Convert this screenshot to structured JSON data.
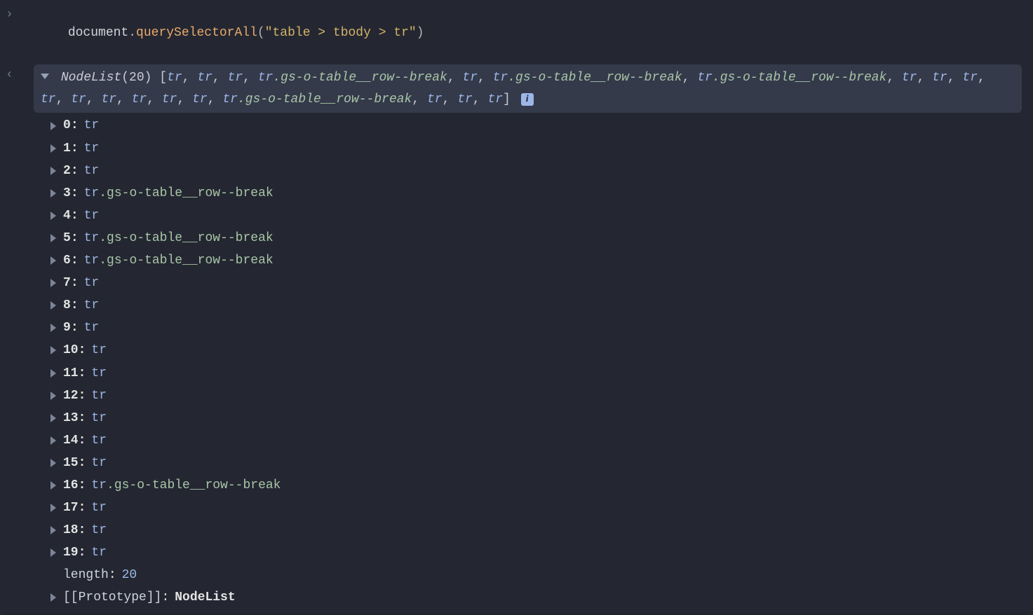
{
  "console": {
    "input": {
      "object": "document",
      "dot1": ".",
      "method": "querySelectorAll",
      "openParen": "(",
      "argString": "\"table > tbody > tr\"",
      "closeParen": ")"
    },
    "result": {
      "typeLabel": "NodeList",
      "count": "20",
      "openCount": "(",
      "closeCount": ")",
      "openBracket": "[",
      "items": [
        {
          "tag": "tr",
          "cls": null
        },
        {
          "tag": "tr",
          "cls": null
        },
        {
          "tag": "tr",
          "cls": null
        },
        {
          "tag": "tr",
          "cls": ".gs-o-table__row--break"
        },
        {
          "tag": "tr",
          "cls": null
        },
        {
          "tag": "tr",
          "cls": ".gs-o-table__row--break"
        },
        {
          "tag": "tr",
          "cls": ".gs-o-table__row--break"
        },
        {
          "tag": "tr",
          "cls": null
        },
        {
          "tag": "tr",
          "cls": null
        },
        {
          "tag": "tr",
          "cls": null
        },
        {
          "tag": "tr",
          "cls": null
        },
        {
          "tag": "tr",
          "cls": null
        },
        {
          "tag": "tr",
          "cls": null
        },
        {
          "tag": "tr",
          "cls": null
        },
        {
          "tag": "tr",
          "cls": null
        },
        {
          "tag": "tr",
          "cls": null
        },
        {
          "tag": "tr",
          "cls": ".gs-o-table__row--break"
        },
        {
          "tag": "tr",
          "cls": null
        },
        {
          "tag": "tr",
          "cls": null
        },
        {
          "tag": "tr",
          "cls": null
        }
      ],
      "closeBracket": "]",
      "infoBadge": "i",
      "tree": {
        "indexed": [
          {
            "idx": "0",
            "tag": "tr",
            "cls": null
          },
          {
            "idx": "1",
            "tag": "tr",
            "cls": null
          },
          {
            "idx": "2",
            "tag": "tr",
            "cls": null
          },
          {
            "idx": "3",
            "tag": "tr",
            "cls": ".gs-o-table__row--break"
          },
          {
            "idx": "4",
            "tag": "tr",
            "cls": null
          },
          {
            "idx": "5",
            "tag": "tr",
            "cls": ".gs-o-table__row--break"
          },
          {
            "idx": "6",
            "tag": "tr",
            "cls": ".gs-o-table__row--break"
          },
          {
            "idx": "7",
            "tag": "tr",
            "cls": null
          },
          {
            "idx": "8",
            "tag": "tr",
            "cls": null
          },
          {
            "idx": "9",
            "tag": "tr",
            "cls": null
          },
          {
            "idx": "10",
            "tag": "tr",
            "cls": null
          },
          {
            "idx": "11",
            "tag": "tr",
            "cls": null
          },
          {
            "idx": "12",
            "tag": "tr",
            "cls": null
          },
          {
            "idx": "13",
            "tag": "tr",
            "cls": null
          },
          {
            "idx": "14",
            "tag": "tr",
            "cls": null
          },
          {
            "idx": "15",
            "tag": "tr",
            "cls": null
          },
          {
            "idx": "16",
            "tag": "tr",
            "cls": ".gs-o-table__row--break"
          },
          {
            "idx": "17",
            "tag": "tr",
            "cls": null
          },
          {
            "idx": "18",
            "tag": "tr",
            "cls": null
          },
          {
            "idx": "19",
            "tag": "tr",
            "cls": null
          }
        ],
        "lengthLabel": "length",
        "lengthValue": "20",
        "protoLabel": "[[Prototype]]",
        "protoValue": "NodeList"
      }
    }
  }
}
